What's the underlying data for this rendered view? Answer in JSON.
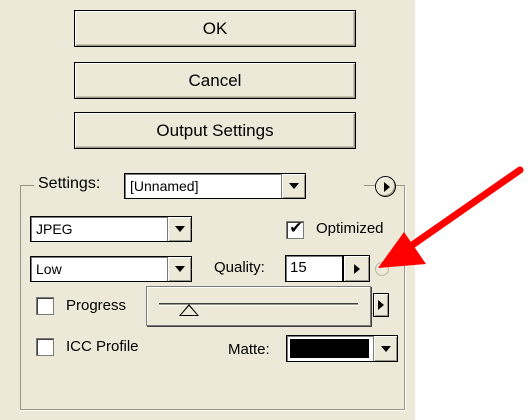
{
  "buttons": {
    "ok": "OK",
    "cancel": "Cancel",
    "output_settings": "Output Settings"
  },
  "settings": {
    "label": "Settings:",
    "preset": "[Unnamed]",
    "menu_icon": "circle-arrow-right-icon"
  },
  "format": {
    "file_type": "JPEG",
    "compression": "Low",
    "optimized_label": "Optimized",
    "optimized_checked": true,
    "quality_label": "Quality:",
    "quality_value": "15",
    "quality_slider_fraction": 0.15
  },
  "options": {
    "progressive_label": "Progress",
    "progressive_checked": false,
    "icc_label": "ICC Profile",
    "icc_checked": false,
    "matte_label": "Matte:",
    "matte_color": "#000000"
  },
  "annotation": {
    "arrow_color": "#ff0000"
  }
}
